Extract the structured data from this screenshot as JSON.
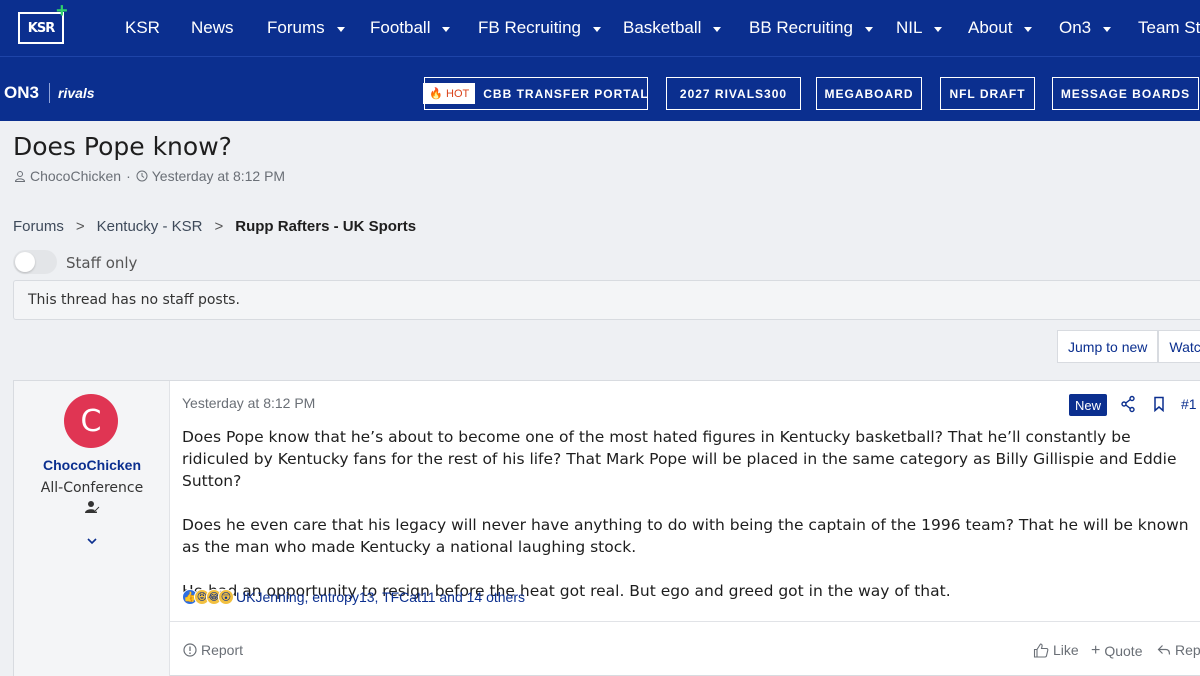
{
  "topnav": {
    "logo_text": "KSR",
    "items": [
      {
        "label": "KSR",
        "dropdown": false
      },
      {
        "label": "News",
        "dropdown": false
      },
      {
        "label": "Forums",
        "dropdown": true
      },
      {
        "label": "Football",
        "dropdown": true
      },
      {
        "label": "FB Recruiting",
        "dropdown": true
      },
      {
        "label": "Basketball",
        "dropdown": true
      },
      {
        "label": "BB Recruiting",
        "dropdown": true
      },
      {
        "label": "NIL",
        "dropdown": true
      },
      {
        "label": "About",
        "dropdown": true
      },
      {
        "label": "On3",
        "dropdown": true
      },
      {
        "label": "Team Store",
        "dropdown": false
      }
    ]
  },
  "subnav": {
    "brand_on3": "ON3",
    "brand_rivals": "rivals",
    "hot_badge": "HOT",
    "buttons": [
      "CBB TRANSFER PORTAL",
      "2027 RIVALS300",
      "MEGABOARD",
      "NFL DRAFT",
      "MESSAGE BOARDS"
    ]
  },
  "thread": {
    "title": "Does Pope know?",
    "author": "ChocoChicken",
    "date": "Yesterday at 8:12 PM"
  },
  "breadcrumb": [
    "Forums",
    "Kentucky - KSR",
    "Rupp Rafters - UK Sports"
  ],
  "staff_toggle": {
    "label": "Staff only",
    "on": false
  },
  "notice": "This thread has no staff posts.",
  "actions": {
    "jump_to_new": "Jump to new",
    "watch": "Watch"
  },
  "post": {
    "avatar_letter": "C",
    "username": "ChocoChicken",
    "user_title": "All-Conference",
    "date": "Yesterday at 8:12 PM",
    "new_badge": "New",
    "number": "#1",
    "paragraphs": [
      "Does Pope know that he’s about to become one of the most hated figures in Kentucky basketball? That he’ll constantly be ridiculed by Kentucky fans for the rest of his life? That Mark Pope will be placed in the same category as Billy Gillispie and Eddie Sutton?",
      "Does he even care that his legacy will never have anything to do with being the captain of the 1996 team? That he will be known as the man who made Kentucky a national laughing stock.",
      "He had an opportunity to resign before the heat got real. But ego and greed got in the way of that."
    ],
    "reactions_text": "UKJenning, entropy13, TFCat11 and 14 others",
    "report": "Report",
    "like": "Like",
    "quote": "Quote",
    "reply": "Reply"
  },
  "colors": {
    "brand": "#0b2f8f",
    "avatar": "#e03553",
    "hot": "#d9431b"
  }
}
